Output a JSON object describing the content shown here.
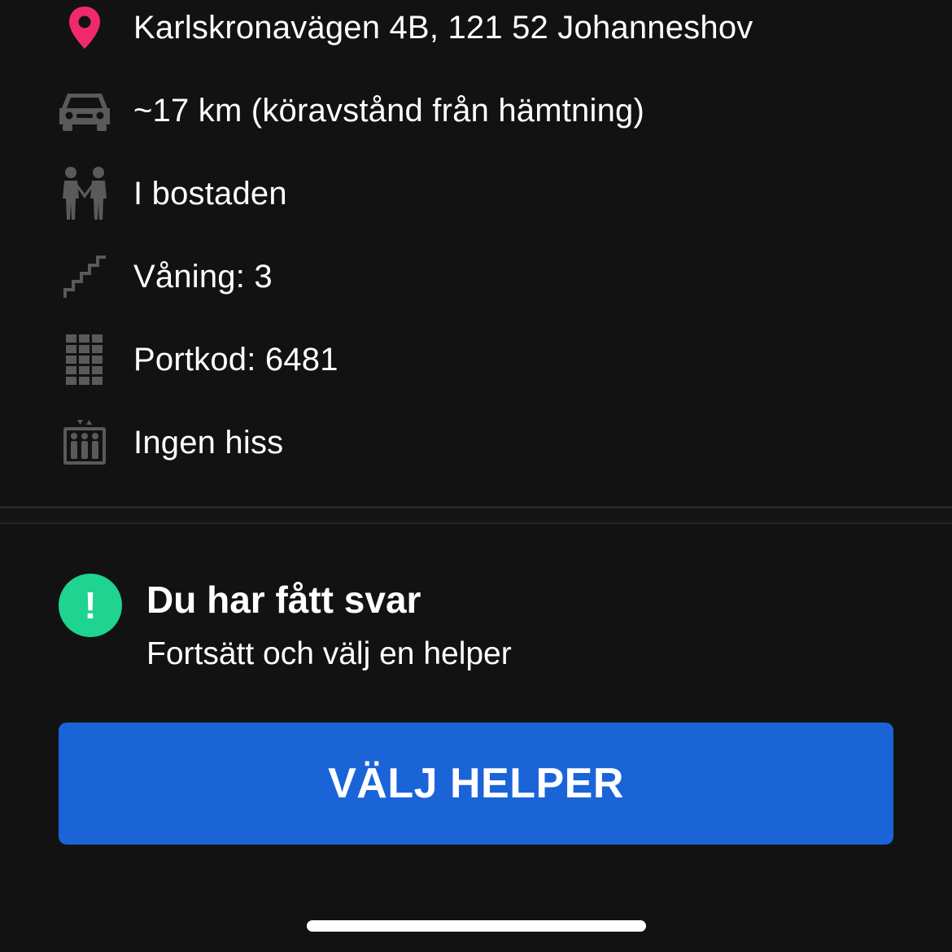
{
  "details": {
    "address": {
      "icon": "map-pin-icon",
      "text": "Karlskronavägen 4B, 121 52 Johanneshov",
      "icon_color": "#f02a6a"
    },
    "distance": {
      "icon": "car-icon",
      "text": "~17 km (köravstånd från hämtning)"
    },
    "location_type": {
      "icon": "people-icon",
      "text": "I bostaden"
    },
    "floor": {
      "icon": "stairs-icon",
      "text": "Våning: 3"
    },
    "door_code": {
      "icon": "keypad-icon",
      "text": "Portkod: 6481"
    },
    "elevator": {
      "icon": "elevator-icon",
      "text": "Ingen hiss"
    }
  },
  "notice": {
    "badge_symbol": "!",
    "badge_color": "#1fd391",
    "title": "Du har fått svar",
    "subtitle": "Fortsätt och välj en helper"
  },
  "cta": {
    "label": "VÄLJ HELPER",
    "color": "#1a64d8"
  }
}
